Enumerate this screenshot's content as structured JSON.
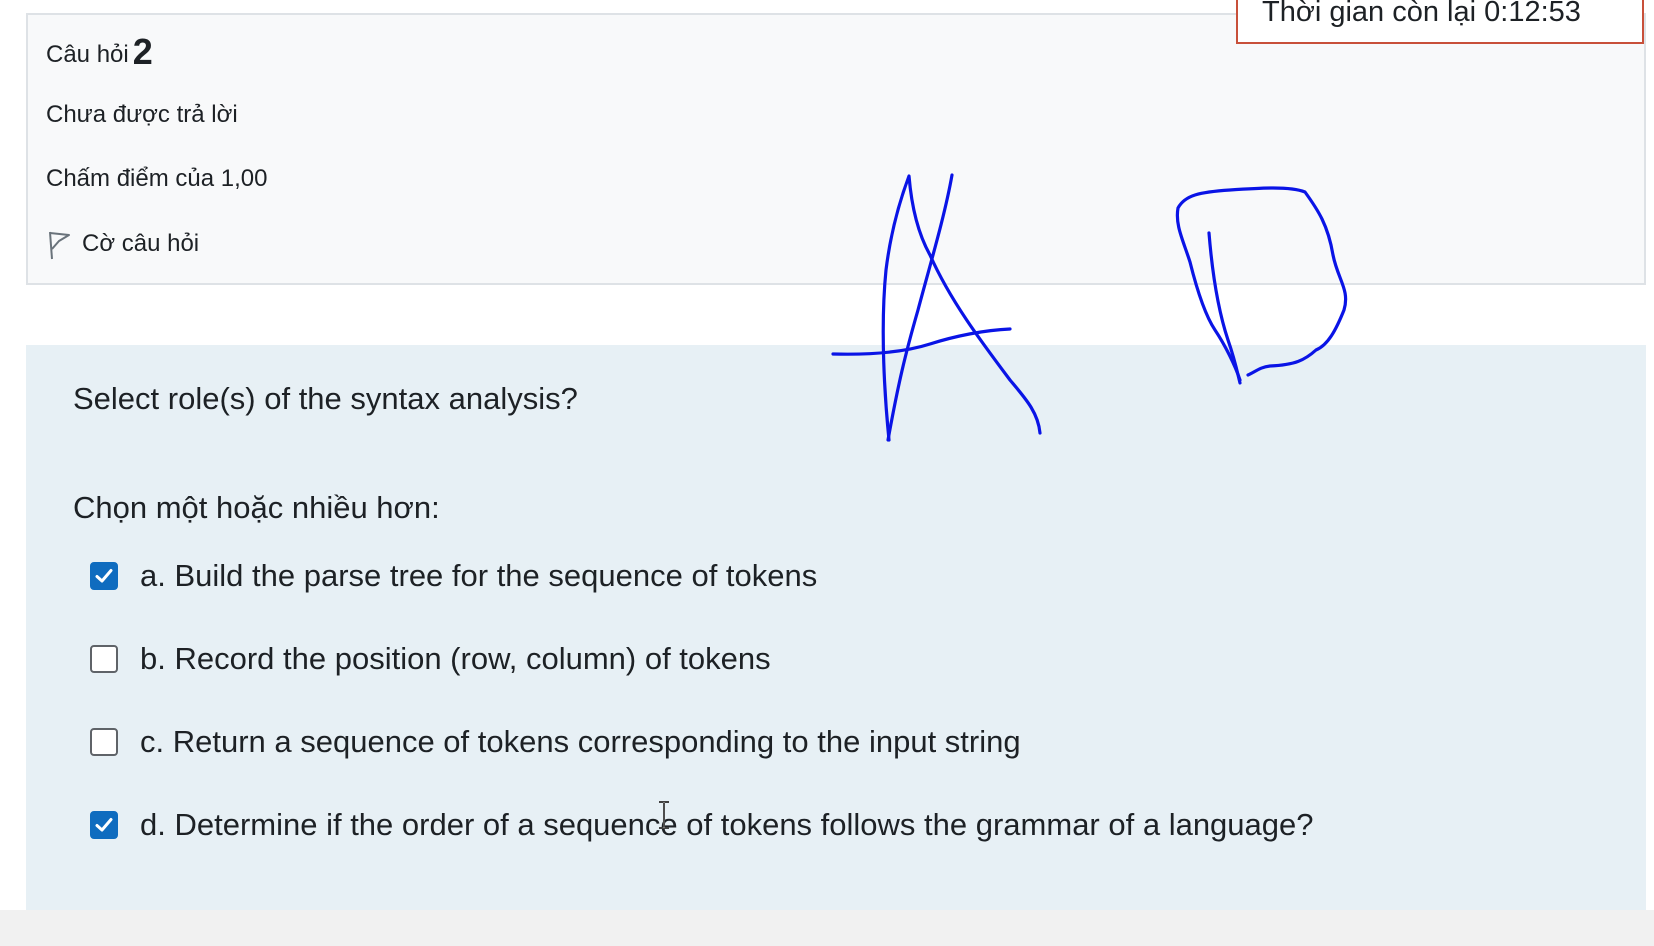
{
  "timer": {
    "text": "Thời gian còn lại 0:12:53"
  },
  "question_info": {
    "label": "Câu hỏi",
    "number": "2",
    "state": "Chưa được trả lời",
    "grade": "Chấm điểm của 1,00",
    "flag_label": "Cờ câu hỏi",
    "flag_icon": "flag-icon"
  },
  "question": {
    "text": "Select role(s) of the syntax analysis?",
    "prompt": "Chọn một hoặc nhiều hơn:",
    "options": [
      {
        "label": "a. Build the parse tree for the sequence of tokens",
        "checked": true
      },
      {
        "label": "b. Record the position (row, column) of tokens",
        "checked": false
      },
      {
        "label": "c. Return a sequence of tokens corresponding to the input string",
        "checked": false
      },
      {
        "label": "d. Determine if the order of a sequence of tokens follows the grammar of a language?",
        "checked": true
      }
    ]
  },
  "annotation": {
    "handwritten_text": "A D",
    "ink_color": "#0a14e6"
  },
  "colors": {
    "accent": "#0f6cbf",
    "timer_border": "#c8503a",
    "info_background": "#f8f9fa",
    "content_background": "#e7f0f5"
  }
}
